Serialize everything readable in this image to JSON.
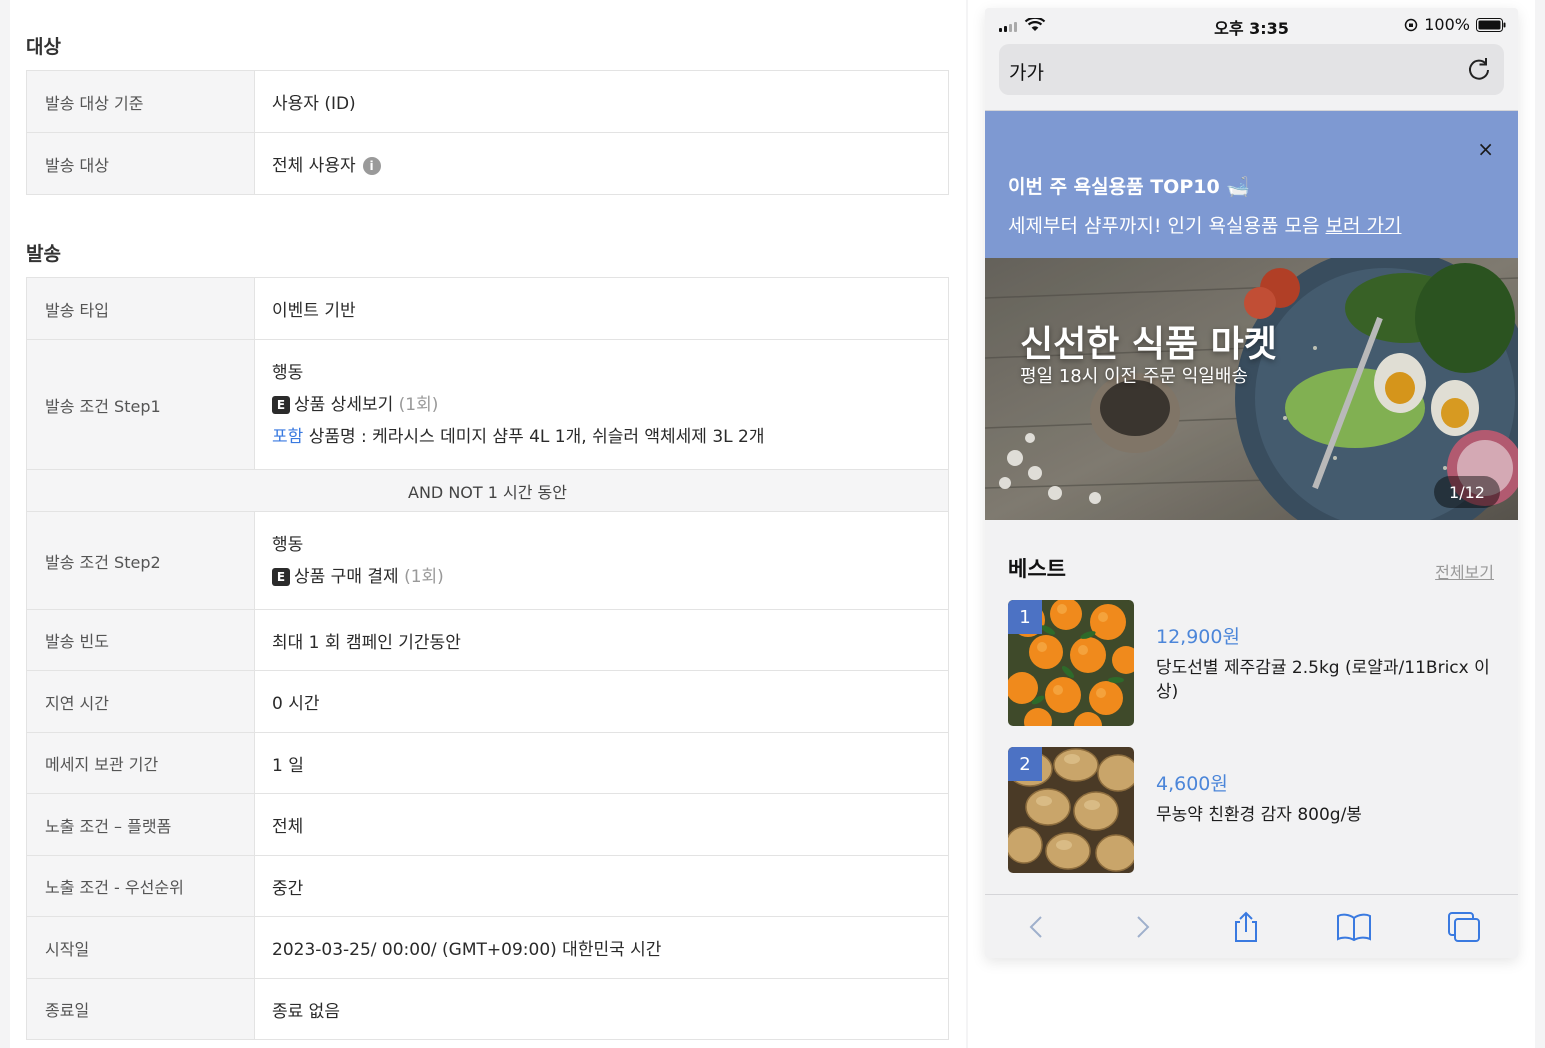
{
  "left": {
    "target_section": {
      "title": "대상",
      "rows": [
        {
          "label": "발송 대상 기준",
          "value": "사용자 (ID)"
        },
        {
          "label": "발송 대상",
          "value": "전체 사용자"
        }
      ]
    },
    "send_section": {
      "title": "발송",
      "type_row": {
        "label": "발송 타입",
        "value": "이벤트 기반"
      },
      "step1": {
        "label": "발송 조건 Step1",
        "heading": "행동",
        "badge": "E",
        "event": "상품 상세보기",
        "count": "(1회)",
        "filter_keyword": "포함",
        "filter_text": "상품명 : 케라시스 데미지 샴푸 4L 1개, 쉬슬러 액체세제 3L 2개"
      },
      "connector": "AND NOT 1 시간 동안",
      "step2": {
        "label": "발송 조건 Step2",
        "heading": "행동",
        "badge": "E",
        "event": "상품 구매 결제",
        "count": "(1회)"
      },
      "rows": [
        {
          "label": "발송 빈도",
          "value": "최대 1 회 캠페인 기간동안"
        },
        {
          "label": "지연 시간",
          "value": "0 시간"
        },
        {
          "label": "메세지 보관 기간",
          "value": "1 일"
        },
        {
          "label": "노출 조건 – 플랫폼",
          "value": "전체"
        },
        {
          "label": "노출 조건 - 우선순위",
          "value": "중간"
        },
        {
          "label": "시작일",
          "value": "2023-03-25/ 00:00/ (GMT+09:00) 대한민국 시간"
        },
        {
          "label": "종료일",
          "value": "종료 없음"
        }
      ]
    }
  },
  "phone": {
    "status": {
      "time": "오후 3:35",
      "battery": "100%"
    },
    "url_bar": {
      "text_size_label": "가가"
    },
    "banner": {
      "title": "이번 주 욕실용품 TOP10 🛁",
      "subtitle": "세제부터 샴푸까지! 인기 욕실용품 모음",
      "link": "보러 가기",
      "close": "×"
    },
    "hero": {
      "title": "신선한 식품 마켓",
      "subtitle": "평일 18시 이전 주문 익일배송",
      "counter": "1/12"
    },
    "best": {
      "title": "베스트",
      "more": "전체보기",
      "products": [
        {
          "rank": "1",
          "price": "12,900원",
          "name": "당도선별 제주감귤 2.5kg (로얄과/11Bricx 이상)"
        },
        {
          "rank": "2",
          "price": "4,600원",
          "name": "무농약 친환경 감자 800g/봉"
        }
      ]
    }
  }
}
